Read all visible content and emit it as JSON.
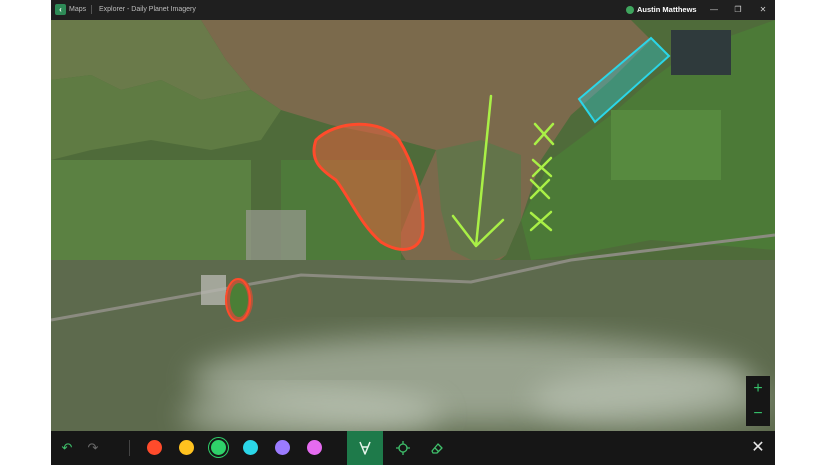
{
  "titlebar": {
    "app_name": "Maps",
    "window_title": "Explorer - Daily Planet Imagery",
    "user_name": "Austin Matthews",
    "minimize_glyph": "—",
    "restore_glyph": "❐",
    "close_glyph": "✕"
  },
  "map": {
    "layer": "aerial",
    "annotations": [
      "red-freehand-region",
      "red-track-outline",
      "green-arrow",
      "green-x-marks",
      "cyan-rectangle"
    ]
  },
  "zoom": {
    "in_label": "+",
    "out_label": "−"
  },
  "toolbar": {
    "undo_glyph": "↶",
    "redo_glyph": "↷",
    "colors": [
      "#ff4b2b",
      "#ffc21f",
      "#2fd16a",
      "#2bd6e8",
      "#9b7bff",
      "#e56bf0"
    ],
    "selected_color": "#2fd16a",
    "close_glyph": "✕"
  }
}
